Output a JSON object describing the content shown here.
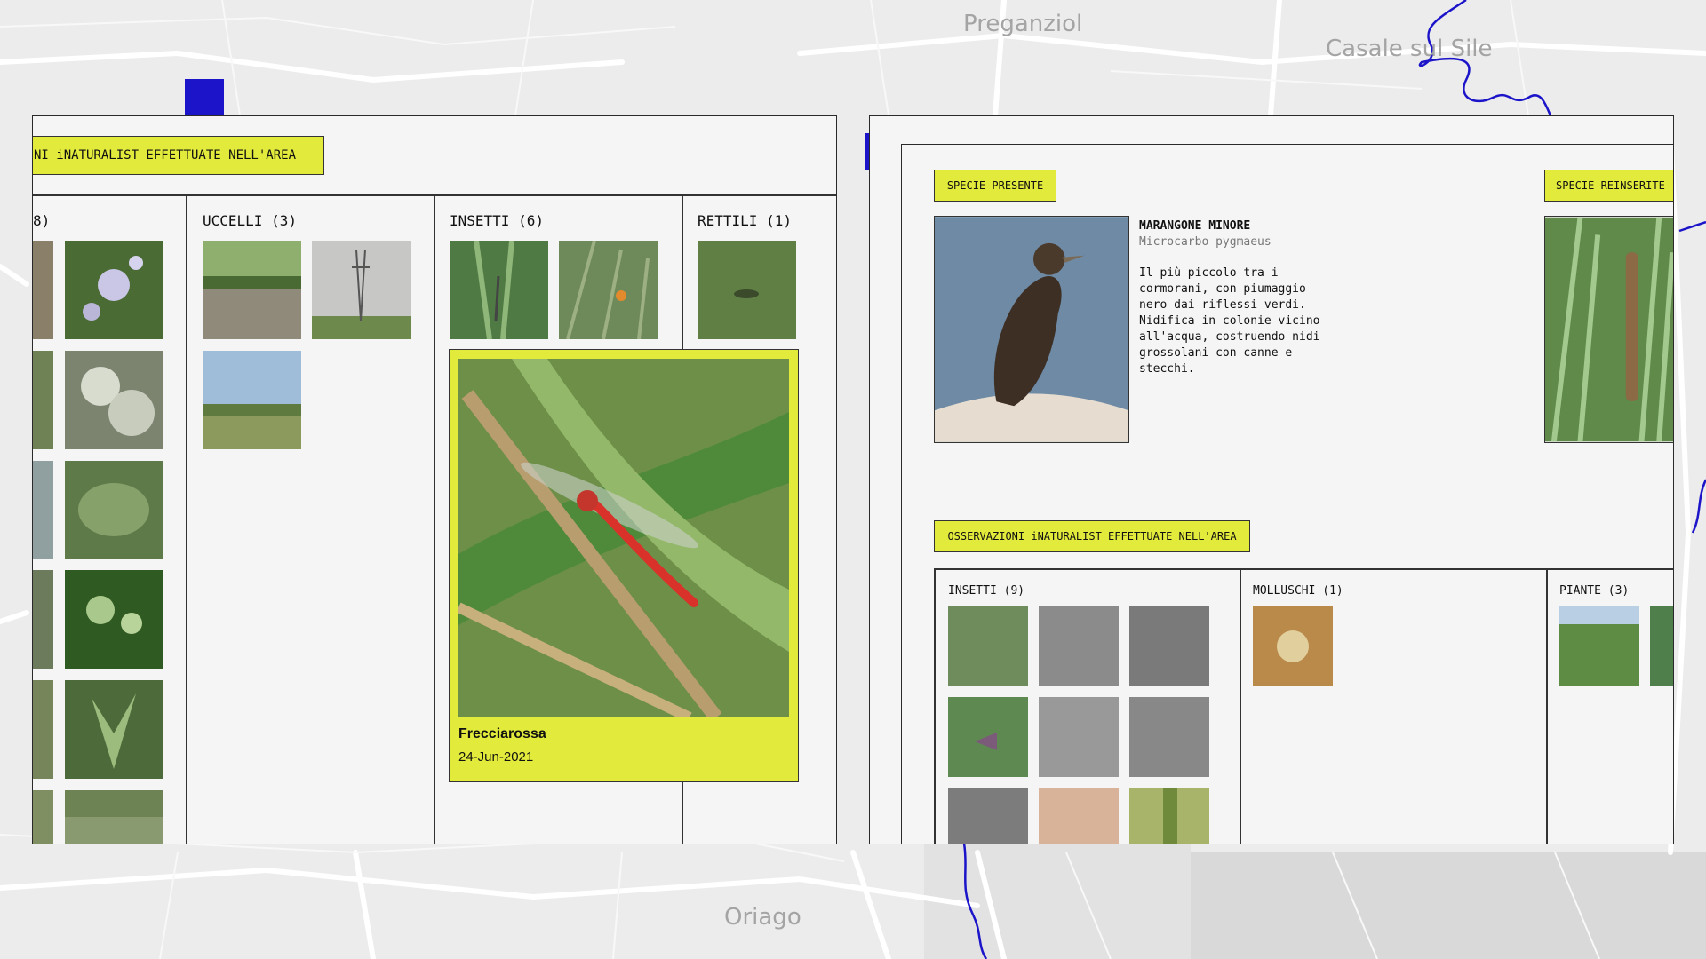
{
  "map": {
    "labels": [
      "Preganziol",
      "Casale sul Sile",
      "Oriago"
    ],
    "colors": {
      "base": "#ececec",
      "roads": "#ffffff",
      "river": "#1c14c9",
      "water": "#d4d4d4"
    }
  },
  "left_panel": {
    "header": "NI iNATURALIST EFFETTUATE NELL'AREA",
    "columns": [
      {
        "label": "8)"
      },
      {
        "label": "UCCELLI (3)"
      },
      {
        "label": "INSETTI (6)"
      },
      {
        "label": "RETTILI (1)"
      }
    ],
    "featured": {
      "name": "Frecciarossa",
      "date": "24-Jun-2021"
    }
  },
  "right_panel": {
    "tag_present": "SPECIE PRESENTE",
    "tag_reintroduced": "SPECIE REINSERITE",
    "species": {
      "name": "MARANGONE MINORE",
      "latin": "Microcarbo pygmaeus",
      "description": "Il più piccolo tra i\ncormorani, con piumaggio\nnero dai riflessi verdi.\nNidifica in colonie vicino\nall'acqua, costruendo nidi\ngrossolani con canne e\nstecchi."
    },
    "observations_header": "OSSERVAZIONI iNATURALIST EFFETTUATE NELL'AREA",
    "columns": [
      {
        "label": "INSETTI (9)"
      },
      {
        "label": "MOLLUSCHI (1)"
      },
      {
        "label": "PIANTE (3)"
      }
    ]
  },
  "accent_color": "#e2eb3b"
}
